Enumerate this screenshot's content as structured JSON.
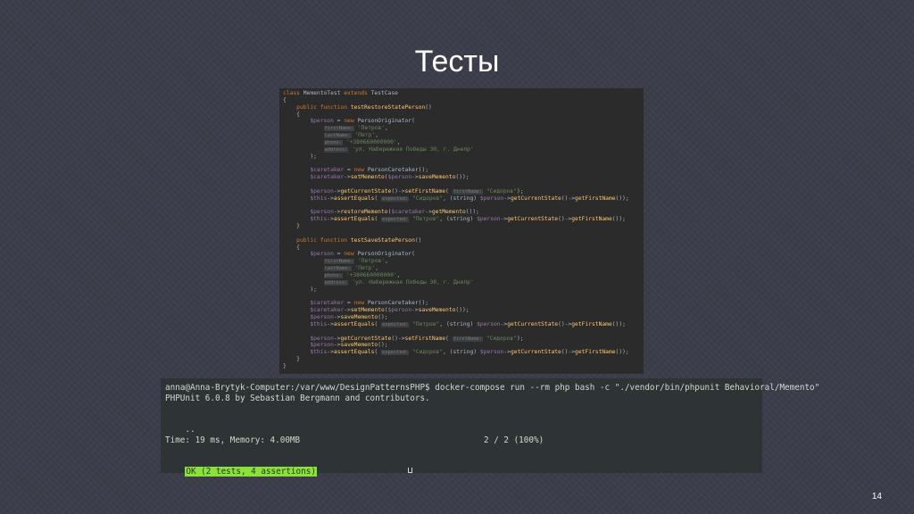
{
  "slide": {
    "title": "Тесты",
    "page_number": "14"
  },
  "code": {
    "lines": [
      [
        {
          "t": "class ",
          "c": "kw"
        },
        {
          "t": "MementoTest "
        },
        {
          "t": "extends ",
          "c": "kw"
        },
        {
          "t": "TestCase"
        }
      ],
      [
        {
          "t": "{"
        }
      ],
      [
        {
          "t": "    "
        },
        {
          "t": "public function ",
          "c": "kw"
        },
        {
          "t": "testRestoreStatePerson",
          "c": "fn"
        },
        {
          "t": "()"
        }
      ],
      [
        {
          "t": "    {"
        }
      ],
      [
        {
          "t": "        "
        },
        {
          "t": "$person",
          "c": "var"
        },
        {
          "t": " = "
        },
        {
          "t": "new ",
          "c": "kw"
        },
        {
          "t": "PersonOriginator("
        }
      ],
      [
        {
          "t": "            "
        },
        {
          "t": "firstName:",
          "c": "hint"
        },
        {
          "t": " "
        },
        {
          "t": "'Петров'",
          "c": "str"
        },
        {
          "t": ","
        }
      ],
      [
        {
          "t": "            "
        },
        {
          "t": "lastName:",
          "c": "hint"
        },
        {
          "t": " "
        },
        {
          "t": "'Петр'",
          "c": "str"
        },
        {
          "t": ","
        }
      ],
      [
        {
          "t": "            "
        },
        {
          "t": "phone:",
          "c": "hint"
        },
        {
          "t": " "
        },
        {
          "t": "'+380660000000'",
          "c": "str"
        },
        {
          "t": ","
        }
      ],
      [
        {
          "t": "            "
        },
        {
          "t": "address:",
          "c": "hint"
        },
        {
          "t": " "
        },
        {
          "t": "'ул. Набережная Победы 30, г. Днепр'",
          "c": "str"
        }
      ],
      [
        {
          "t": "        );"
        }
      ],
      [
        {
          "t": ""
        }
      ],
      [
        {
          "t": "        "
        },
        {
          "t": "$caretaker",
          "c": "var"
        },
        {
          "t": " = "
        },
        {
          "t": "new ",
          "c": "kw"
        },
        {
          "t": "PersonCaretaker();"
        }
      ],
      [
        {
          "t": "        "
        },
        {
          "t": "$caretaker",
          "c": "var"
        },
        {
          "t": "->"
        },
        {
          "t": "setMemento",
          "c": "fn"
        },
        {
          "t": "("
        },
        {
          "t": "$person",
          "c": "var"
        },
        {
          "t": "->"
        },
        {
          "t": "saveMemento",
          "c": "fn"
        },
        {
          "t": "());"
        }
      ],
      [
        {
          "t": ""
        }
      ],
      [
        {
          "t": "        "
        },
        {
          "t": "$person",
          "c": "var"
        },
        {
          "t": "->"
        },
        {
          "t": "getCurrentState",
          "c": "fn"
        },
        {
          "t": "()->"
        },
        {
          "t": "setFirstName",
          "c": "fn"
        },
        {
          "t": "( "
        },
        {
          "t": "firstName:",
          "c": "hint"
        },
        {
          "t": " "
        },
        {
          "t": "\"Сидоров\"",
          "c": "str"
        },
        {
          "t": ");"
        }
      ],
      [
        {
          "t": "        "
        },
        {
          "t": "$this",
          "c": "var"
        },
        {
          "t": "->"
        },
        {
          "t": "assertEquals",
          "c": "fn"
        },
        {
          "t": "( "
        },
        {
          "t": "expected:",
          "c": "hint"
        },
        {
          "t": " "
        },
        {
          "t": "\"Сидоров\"",
          "c": "str"
        },
        {
          "t": ", (string) "
        },
        {
          "t": "$person",
          "c": "var"
        },
        {
          "t": "->"
        },
        {
          "t": "getCurrentState",
          "c": "fn"
        },
        {
          "t": "()->"
        },
        {
          "t": "getFirstName",
          "c": "fn"
        },
        {
          "t": "());"
        }
      ],
      [
        {
          "t": ""
        }
      ],
      [
        {
          "t": "        "
        },
        {
          "t": "$person",
          "c": "var"
        },
        {
          "t": "->"
        },
        {
          "t": "restoreMemento",
          "c": "fn"
        },
        {
          "t": "("
        },
        {
          "t": "$caretaker",
          "c": "var"
        },
        {
          "t": "->"
        },
        {
          "t": "getMemento",
          "c": "fn"
        },
        {
          "t": "());"
        }
      ],
      [
        {
          "t": "        "
        },
        {
          "t": "$this",
          "c": "var"
        },
        {
          "t": "->"
        },
        {
          "t": "assertEquals",
          "c": "fn"
        },
        {
          "t": "( "
        },
        {
          "t": "expected:",
          "c": "hint"
        },
        {
          "t": " "
        },
        {
          "t": "\"Петров\"",
          "c": "str"
        },
        {
          "t": ", (string) "
        },
        {
          "t": "$person",
          "c": "var"
        },
        {
          "t": "->"
        },
        {
          "t": "getCurrentState",
          "c": "fn"
        },
        {
          "t": "()->"
        },
        {
          "t": "getFirstName",
          "c": "fn"
        },
        {
          "t": "());"
        }
      ],
      [
        {
          "t": "    }"
        }
      ],
      [
        {
          "t": ""
        }
      ],
      [
        {
          "t": "    "
        },
        {
          "t": "public function ",
          "c": "kw"
        },
        {
          "t": "testSaveStatePerson",
          "c": "fn"
        },
        {
          "t": "()"
        }
      ],
      [
        {
          "t": "    {"
        }
      ],
      [
        {
          "t": "        "
        },
        {
          "t": "$person",
          "c": "var"
        },
        {
          "t": " = "
        },
        {
          "t": "new ",
          "c": "kw"
        },
        {
          "t": "PersonOriginator("
        }
      ],
      [
        {
          "t": "            "
        },
        {
          "t": "firstName:",
          "c": "hint"
        },
        {
          "t": " "
        },
        {
          "t": "'Петров'",
          "c": "str"
        },
        {
          "t": ","
        }
      ],
      [
        {
          "t": "            "
        },
        {
          "t": "lastName:",
          "c": "hint"
        },
        {
          "t": " "
        },
        {
          "t": "'Петр'",
          "c": "str"
        },
        {
          "t": ","
        }
      ],
      [
        {
          "t": "            "
        },
        {
          "t": "phone:",
          "c": "hint"
        },
        {
          "t": " "
        },
        {
          "t": "'+380660000000'",
          "c": "str"
        },
        {
          "t": ","
        }
      ],
      [
        {
          "t": "            "
        },
        {
          "t": "address:",
          "c": "hint"
        },
        {
          "t": " "
        },
        {
          "t": "'ул. Набережная Победы 30, г. Днепр'",
          "c": "str"
        }
      ],
      [
        {
          "t": "        );"
        }
      ],
      [
        {
          "t": ""
        }
      ],
      [
        {
          "t": "        "
        },
        {
          "t": "$caretaker",
          "c": "var"
        },
        {
          "t": " = "
        },
        {
          "t": "new ",
          "c": "kw"
        },
        {
          "t": "PersonCaretaker();"
        }
      ],
      [
        {
          "t": "        "
        },
        {
          "t": "$caretaker",
          "c": "var"
        },
        {
          "t": "->"
        },
        {
          "t": "setMemento",
          "c": "fn"
        },
        {
          "t": "("
        },
        {
          "t": "$person",
          "c": "var"
        },
        {
          "t": "->"
        },
        {
          "t": "saveMemento",
          "c": "fn"
        },
        {
          "t": "());"
        }
      ],
      [
        {
          "t": "        "
        },
        {
          "t": "$person",
          "c": "var"
        },
        {
          "t": "->"
        },
        {
          "t": "saveMemento",
          "c": "fn"
        },
        {
          "t": "();"
        }
      ],
      [
        {
          "t": "        "
        },
        {
          "t": "$this",
          "c": "var"
        },
        {
          "t": "->"
        },
        {
          "t": "assertEquals",
          "c": "fn"
        },
        {
          "t": "( "
        },
        {
          "t": "expected:",
          "c": "hint"
        },
        {
          "t": " "
        },
        {
          "t": "\"Петров\"",
          "c": "str"
        },
        {
          "t": ", (string) "
        },
        {
          "t": "$person",
          "c": "var"
        },
        {
          "t": "->"
        },
        {
          "t": "getCurrentState",
          "c": "fn"
        },
        {
          "t": "()->"
        },
        {
          "t": "getFirstName",
          "c": "fn"
        },
        {
          "t": "());"
        }
      ],
      [
        {
          "t": ""
        }
      ],
      [
        {
          "t": "        "
        },
        {
          "t": "$person",
          "c": "var"
        },
        {
          "t": "->"
        },
        {
          "t": "getCurrentState",
          "c": "fn"
        },
        {
          "t": "()->"
        },
        {
          "t": "setFirstName",
          "c": "fn"
        },
        {
          "t": "( "
        },
        {
          "t": "firstName:",
          "c": "hint"
        },
        {
          "t": " "
        },
        {
          "t": "\"Сидоров\"",
          "c": "str"
        },
        {
          "t": ");"
        }
      ],
      [
        {
          "t": "        "
        },
        {
          "t": "$person",
          "c": "var"
        },
        {
          "t": "->"
        },
        {
          "t": "saveMemento",
          "c": "fn"
        },
        {
          "t": "();"
        }
      ],
      [
        {
          "t": "        "
        },
        {
          "t": "$this",
          "c": "var"
        },
        {
          "t": "->"
        },
        {
          "t": "assertEquals",
          "c": "fn"
        },
        {
          "t": "( "
        },
        {
          "t": "expected:",
          "c": "hint"
        },
        {
          "t": " "
        },
        {
          "t": "\"Сидоров\"",
          "c": "str"
        },
        {
          "t": ", (string) "
        },
        {
          "t": "$person",
          "c": "var"
        },
        {
          "t": "->"
        },
        {
          "t": "getCurrentState",
          "c": "fn"
        },
        {
          "t": "()->"
        },
        {
          "t": "getFirstName",
          "c": "fn"
        },
        {
          "t": "());"
        }
      ],
      [
        {
          "t": "    }"
        }
      ],
      [
        {
          "t": "}"
        }
      ]
    ]
  },
  "terminal": {
    "command_line": "anna@Anna-Brytyk-Computer:/var/www/DesignPatternsPHP$ docker-compose run --rm php bash -c \"./vendor/bin/phpunit Behavioral/Memento\"",
    "phpunit_line": "PHPUnit 6.0.8 by Sebastian Bergmann and contributors.",
    "dots": "..",
    "progress": "2 / 2 (100%)",
    "time_line": "Time: 19 ms, Memory: 4.00MB",
    "ok_line": "OK (2 tests, 4 assertions)"
  },
  "colors": {
    "background": "#3b3d4a",
    "editor_bg": "#2b2b2b",
    "terminal_bg": "#2e3436",
    "ok_bar": "#8ae234",
    "keyword": "#cc7832",
    "function": "#ffc66d",
    "variable": "#9876aa",
    "string": "#6a8759"
  }
}
